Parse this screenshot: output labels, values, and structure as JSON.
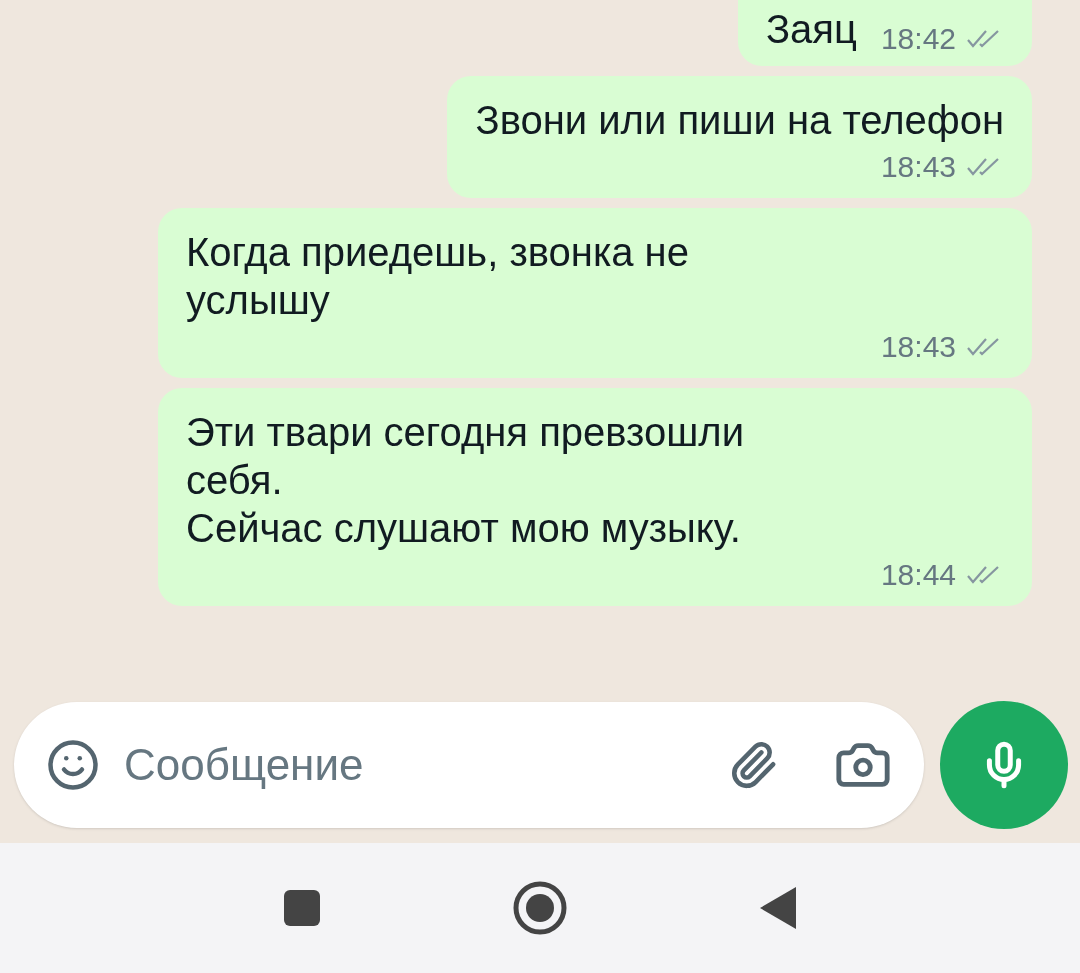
{
  "messages": [
    {
      "lines": [
        "Заяц"
      ],
      "time": "18:42",
      "read": false
    },
    {
      "lines": [
        "Звони или пиши на телефон"
      ],
      "time": "18:43",
      "read": false
    },
    {
      "lines": [
        "Когда приедешь, звонка не",
        "услышу"
      ],
      "time": "18:43",
      "read": false
    },
    {
      "lines": [
        "Эти твари сегодня превзошли",
        "себя.",
        "Сейчас слушают мою музыку."
      ],
      "time": "18:44",
      "read": false
    }
  ],
  "composer": {
    "placeholder": "Сообщение"
  }
}
